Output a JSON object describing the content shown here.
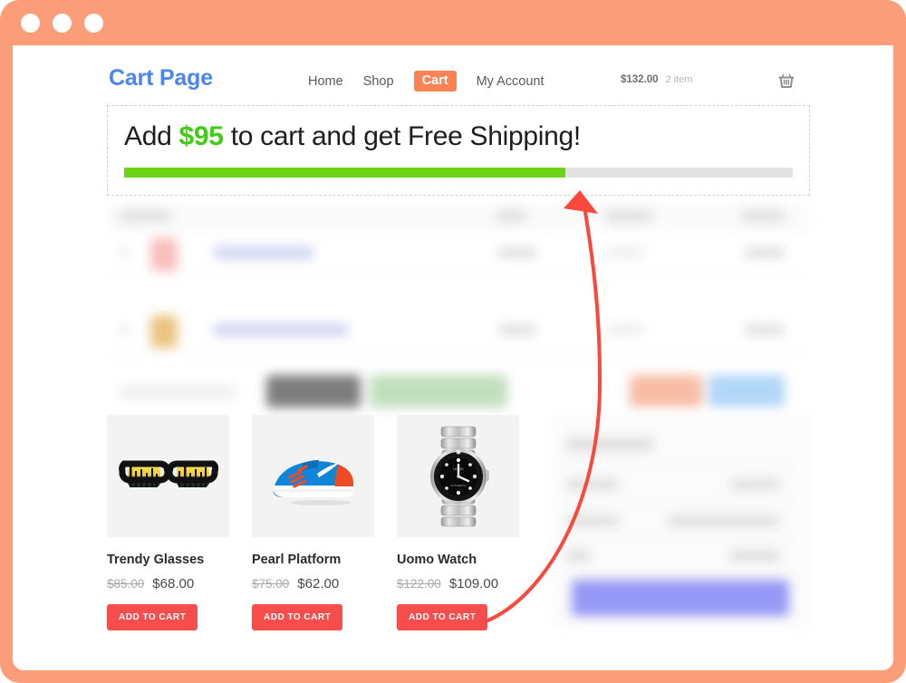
{
  "window": {
    "titlebar_color": "#fb9d78",
    "dots": [
      "close-dot",
      "minimize-dot",
      "maximize-dot"
    ]
  },
  "header": {
    "brand": "Cart Page",
    "brand_color": "#4a86ee",
    "nav": [
      {
        "label": "Home",
        "active": false
      },
      {
        "label": "Shop",
        "active": false
      },
      {
        "label": "Cart",
        "active": true
      },
      {
        "label": "My Account",
        "active": false
      }
    ],
    "cart": {
      "total": "$132.00",
      "count": "2 item",
      "icon": "shopping-basket-icon"
    }
  },
  "banner": {
    "prefix": "Add ",
    "amount": "$95",
    "suffix": " to cart and get Free Shipping!",
    "amount_color": "#3fcc12",
    "progress_percent": 66,
    "progress_fill_color": "#6cd415",
    "progress_track_color": "#e2e2e2"
  },
  "cart_table": {
    "blurred": true,
    "columns": [
      "Product",
      "Price",
      "Quantity",
      "Subtotal"
    ],
    "rows": [
      {
        "thumb": "pink",
        "name_skeleton": true
      },
      {
        "thumb": "gold",
        "name_skeleton": true
      }
    ],
    "actions": {
      "coupon_placeholder": "Coupon code",
      "apply_button_color": "#6f6f6f",
      "update_button_color": "#b9dcb5",
      "secondary_button_color": "#f6b59b",
      "tertiary_button_color": "#a9d2f7"
    }
  },
  "products": [
    {
      "name": "Trendy Glasses",
      "image": "sunglasses-image",
      "price_old": "$85.00",
      "price_new": "$68.00",
      "button": "ADD TO CART"
    },
    {
      "name": "Pearl Platform",
      "image": "running-shoe-image",
      "price_old": "$75.00",
      "price_new": "$62.00",
      "button": "ADD TO CART"
    },
    {
      "name": "Uomo Watch",
      "image": "wristwatch-image",
      "price_old": "$122.00",
      "price_new": "$109.00",
      "button": "ADD TO CART"
    }
  ],
  "totals_panel": {
    "blurred": true,
    "rows": [
      "Cart totals",
      "Subtotal",
      "Shipping",
      "Total"
    ],
    "checkout_button_color": "#8d90f5"
  },
  "annotation": {
    "arrow_color": "#f9493f",
    "from": "add-to-cart-uomo-watch",
    "to": "free-shipping-progress-bar"
  }
}
